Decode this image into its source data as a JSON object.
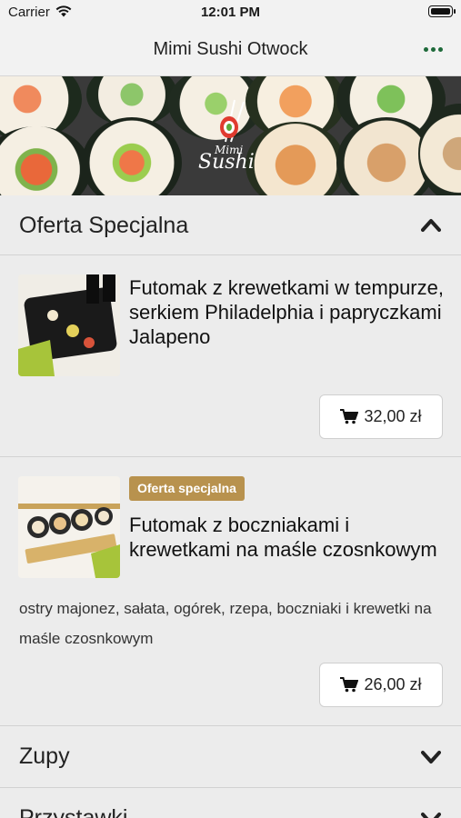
{
  "status_bar": {
    "carrier": "Carrier",
    "time": "12:01 PM"
  },
  "nav": {
    "title": "Mimi Sushi Otwock",
    "more_icon": "more-dots-icon",
    "accent": "#1e6a3a"
  },
  "hero": {
    "logo_small": "Mimi",
    "logo_big": "Sushi"
  },
  "sections": [
    {
      "label": "Oferta Specjalna",
      "expanded": true
    },
    {
      "label": "Zupy",
      "expanded": false
    },
    {
      "label": "Przystawki",
      "expanded": false
    }
  ],
  "items": [
    {
      "name": "Futomak z krewetkami w tempurze, serkiem Philadelphia i papryczkami Jalapeno",
      "price": "32,00 zł"
    },
    {
      "badge": "Oferta specjalna",
      "name": "Futomak z boczniakami i krewetkami na maśle czosnkowym",
      "description": "ostry majonez, sałata, ogórek, rzepa, boczniaki i krewetki na maśle czosnkowym",
      "price": "26,00 zł"
    }
  ],
  "colors": {
    "badge": "#b8924e",
    "background": "#ececec"
  }
}
